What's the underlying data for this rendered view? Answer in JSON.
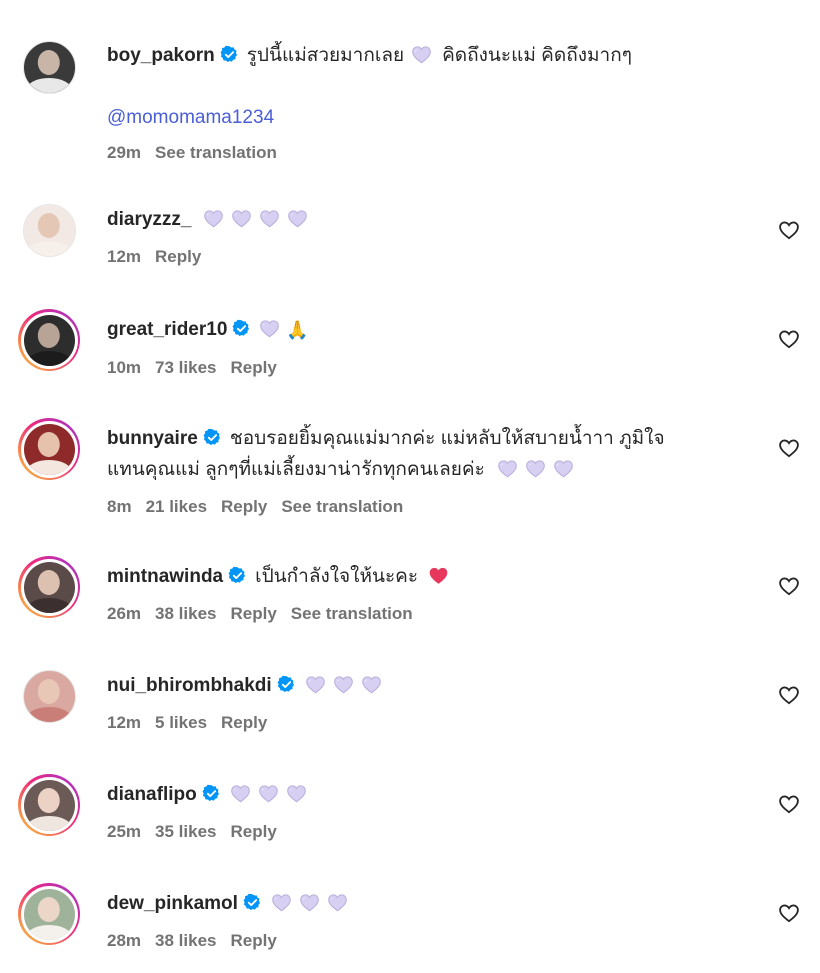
{
  "colors": {
    "lavender_heart": "#d8d0f3",
    "lavender_stroke": "#b9addc",
    "verified_blue": "#0095f6",
    "mention_blue": "#4a5ed6",
    "red_heart": "#e8375c"
  },
  "comments": [
    {
      "username": "boy_pakorn",
      "verified": true,
      "text": "รูปนี้แม่สวยมากเลย",
      "emojis_after_first": [
        "lavender-heart"
      ],
      "text_2": "คิดถึงนะแม่ คิดถึงมากๆ",
      "mention": "@momomama1234",
      "time": "29m",
      "likes": "",
      "reply_label": "",
      "translation_label": "See translation",
      "has_like_button": false
    },
    {
      "username": "diaryzzz_",
      "verified": false,
      "text": "",
      "emojis": [
        "lavender-heart",
        "lavender-heart",
        "lavender-heart",
        "lavender-heart"
      ],
      "time": "12m",
      "likes": "",
      "reply_label": "Reply",
      "translation_label": "",
      "has_like_button": true
    },
    {
      "username": "great_rider10",
      "verified": true,
      "text": "",
      "emojis": [
        "lavender-heart",
        "folded-hands"
      ],
      "time": "10m",
      "likes": "73 likes",
      "reply_label": "Reply",
      "translation_label": "",
      "has_like_button": true
    },
    {
      "username": "bunnyaire",
      "verified": true,
      "text": "ชอบรอยยิ้มคุณแม่มากค่ะ แม่หลับให้สบายน้ำาา ภูมิใจ",
      "text_line2": "แทนคุณแม่ ลูกๆที่แม่เลี้ยงมาน่ารักทุกคนเลยค่ะ",
      "emojis": [
        "lavender-heart",
        "lavender-heart",
        "lavender-heart"
      ],
      "time": "8m",
      "likes": "21 likes",
      "reply_label": "Reply",
      "translation_label": "See translation",
      "has_like_button": true
    },
    {
      "username": "mintnawinda",
      "verified": true,
      "text": "เป็นกำลังใจให้นะคะ",
      "emojis": [
        "red-heart"
      ],
      "time": "26m",
      "likes": "38 likes",
      "reply_label": "Reply",
      "translation_label": "See translation",
      "has_like_button": true
    },
    {
      "username": "nui_bhirombhakdi",
      "verified": true,
      "text": "",
      "emojis": [
        "lavender-heart",
        "lavender-heart",
        "lavender-heart"
      ],
      "time": "12m",
      "likes": "5 likes",
      "reply_label": "Reply",
      "translation_label": "",
      "has_like_button": true
    },
    {
      "username": "dianaflipo",
      "verified": true,
      "text": "",
      "emojis": [
        "lavender-heart",
        "lavender-heart",
        "lavender-heart"
      ],
      "time": "25m",
      "likes": "35 likes",
      "reply_label": "Reply",
      "translation_label": "",
      "has_like_button": true
    },
    {
      "username": "dew_pinkamol",
      "verified": true,
      "text": "",
      "emojis": [
        "lavender-heart",
        "lavender-heart",
        "lavender-heart"
      ],
      "time": "28m",
      "likes": "38 likes",
      "reply_label": "Reply",
      "translation_label": "",
      "has_like_button": true
    }
  ]
}
